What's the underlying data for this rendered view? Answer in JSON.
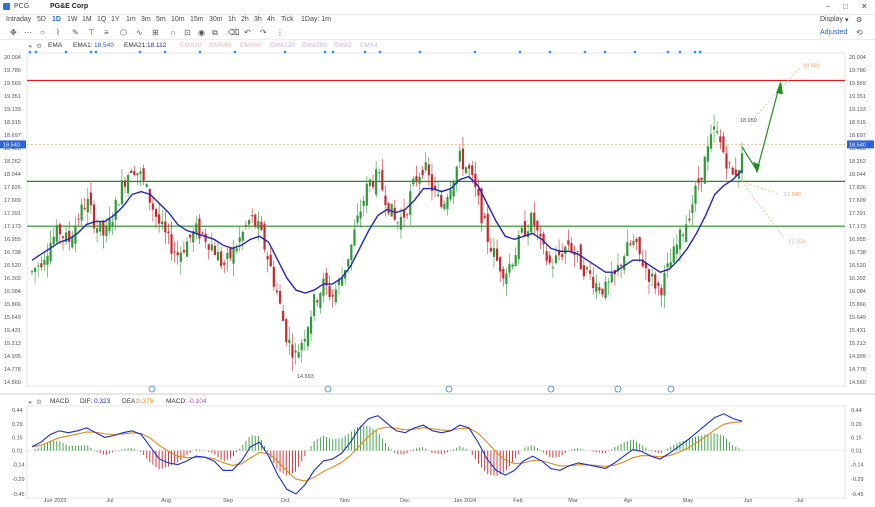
{
  "window": {
    "symbol": "PCG",
    "name": "PG&E Corp",
    "display_label": "Display"
  },
  "timeframes": [
    "Intraday",
    "5D",
    "1D",
    "1W",
    "1M",
    "1Q",
    "1Y",
    "1m",
    "3m",
    "5m",
    "10m",
    "15m",
    "30m",
    "1h",
    "2h",
    "3h",
    "4h",
    "Tick",
    "1Day: 1m"
  ],
  "active_timeframe": "1D",
  "adjust_label": "Adjusted",
  "indicators": {
    "main": "EMA",
    "ema1_label": "EMA1:",
    "ema1_value": "18.540",
    "ema2_label": "EMA21:",
    "ema2_value": "18.112",
    "faded": [
      "EMA20",
      "EMA30",
      "EMA60",
      "EMA120",
      "EMA200",
      "EMA3",
      "EMA4"
    ]
  },
  "macd_bar": {
    "main": "MACD",
    "dif_label": "DIF:",
    "dif_value": "0.323",
    "dea_label": "DEA:",
    "dea_value": "0.375",
    "macd_label": "MACD:",
    "macd_value": "-0.104"
  },
  "colors": {
    "ema_fast": "#2b63d8",
    "ema_slow": "#2424b8",
    "up": "#2e9b39",
    "down": "#c9282d",
    "resistance": "#d62020",
    "support": "#1e8f1e",
    "dea": "#e08a1c",
    "dif": "#1a2ecc",
    "projection": "#f0a060"
  },
  "chart_data": {
    "type": "candlestick",
    "price_axis_ticks": [
      "20.004",
      "19.786",
      "19.569",
      "19.351",
      "19.133",
      "18.915",
      "18.697",
      "18.480",
      "18.262",
      "18.044",
      "17.826",
      "17.609",
      "17.391",
      "17.173",
      "16.955",
      "16.738",
      "16.520",
      "16.302",
      "16.084",
      "15.866",
      "15.649",
      "15.431",
      "15.213",
      "14.995",
      "14.778",
      "14.560"
    ],
    "ylim": [
      14.56,
      20.004
    ],
    "last_price": "18.540",
    "x_ticks": [
      "Jun 2023",
      "Jul",
      "Aug",
      "Sep",
      "Oct",
      "Nov",
      "Dec",
      "Jan 2024",
      "Feb",
      "Mar",
      "Apr",
      "May",
      "Jun",
      "Jul"
    ],
    "horizontal_levels": [
      {
        "price": 19.61,
        "color": "#d62020"
      },
      {
        "price": 17.92,
        "color": "#1e8f1e"
      },
      {
        "price": 17.17,
        "color": "#1e8f1e"
      }
    ],
    "annotations": [
      {
        "text": "19.560",
        "price": 19.56
      },
      {
        "text": "18.950",
        "price": 18.95
      },
      {
        "text": "17.940",
        "price": 17.94
      },
      {
        "text": "17.150",
        "price": 17.15
      },
      {
        "text": "14.693",
        "price": 14.693
      }
    ],
    "macd_axis_ticks": [
      "0.44",
      "0.29",
      "0.15",
      "0.01",
      "-0.14",
      "-0.29",
      "-0.45"
    ],
    "macd_ylim": [
      -0.45,
      0.44
    ],
    "close_path": [
      16.4,
      16.6,
      16.9,
      17.1,
      16.9,
      17.3,
      17.6,
      17.2,
      17.0,
      17.4,
      17.9,
      18.2,
      18.0,
      17.6,
      17.2,
      16.9,
      16.7,
      16.9,
      17.1,
      17.0,
      16.8,
      16.5,
      16.7,
      17.0,
      17.3,
      17.1,
      16.6,
      16.0,
      15.3,
      15.0,
      15.4,
      15.9,
      16.2,
      16.0,
      16.3,
      16.8,
      17.4,
      17.9,
      18.0,
      17.6,
      17.2,
      17.4,
      17.9,
      18.2,
      17.8,
      17.5,
      17.9,
      18.3,
      18.1,
      17.6,
      17.0,
      16.6,
      16.4,
      16.7,
      17.1,
      17.3,
      16.8,
      16.5,
      16.7,
      16.9,
      16.6,
      16.4,
      16.2,
      16.1,
      16.3,
      16.7,
      16.9,
      16.6,
      16.3,
      16.1,
      16.5,
      16.9,
      17.3,
      17.8,
      18.3,
      18.8,
      18.4,
      18.0,
      18.3
    ],
    "ema_slow_path": [
      16.6,
      16.7,
      16.8,
      16.9,
      16.95,
      17.05,
      17.2,
      17.25,
      17.25,
      17.35,
      17.5,
      17.7,
      17.75,
      17.7,
      17.55,
      17.4,
      17.2,
      17.1,
      17.05,
      17.0,
      16.95,
      16.85,
      16.8,
      16.85,
      16.95,
      17.0,
      16.9,
      16.6,
      16.3,
      16.1,
      16.05,
      16.1,
      16.2,
      16.2,
      16.3,
      16.5,
      16.8,
      17.1,
      17.35,
      17.45,
      17.4,
      17.45,
      17.6,
      17.8,
      17.8,
      17.75,
      17.8,
      17.95,
      18.0,
      17.85,
      17.55,
      17.25,
      17.0,
      16.95,
      17.0,
      17.05,
      16.95,
      16.8,
      16.75,
      16.75,
      16.7,
      16.6,
      16.5,
      16.4,
      16.4,
      16.5,
      16.6,
      16.6,
      16.5,
      16.4,
      16.45,
      16.6,
      16.8,
      17.05,
      17.35,
      17.7,
      17.85,
      17.95,
      18.11
    ],
    "macd_dif_path": [
      0.05,
      0.1,
      0.18,
      0.22,
      0.2,
      0.22,
      0.25,
      0.2,
      0.15,
      0.17,
      0.2,
      0.22,
      0.18,
      0.05,
      -0.08,
      -0.12,
      -0.14,
      -0.1,
      -0.05,
      -0.06,
      -0.1,
      -0.2,
      -0.2,
      -0.1,
      0.05,
      0.1,
      -0.05,
      -0.25,
      -0.4,
      -0.45,
      -0.35,
      -0.2,
      -0.1,
      -0.08,
      -0.02,
      0.1,
      0.25,
      0.35,
      0.38,
      0.3,
      0.22,
      0.2,
      0.25,
      0.28,
      0.22,
      0.2,
      0.22,
      0.28,
      0.25,
      0.1,
      -0.08,
      -0.2,
      -0.25,
      -0.2,
      -0.1,
      -0.05,
      -0.1,
      -0.18,
      -0.2,
      -0.15,
      -0.12,
      -0.14,
      -0.16,
      -0.18,
      -0.12,
      -0.05,
      0.02,
      0.0,
      -0.05,
      -0.08,
      -0.02,
      0.05,
      0.12,
      0.2,
      0.28,
      0.36,
      0.4,
      0.35,
      0.32
    ]
  }
}
